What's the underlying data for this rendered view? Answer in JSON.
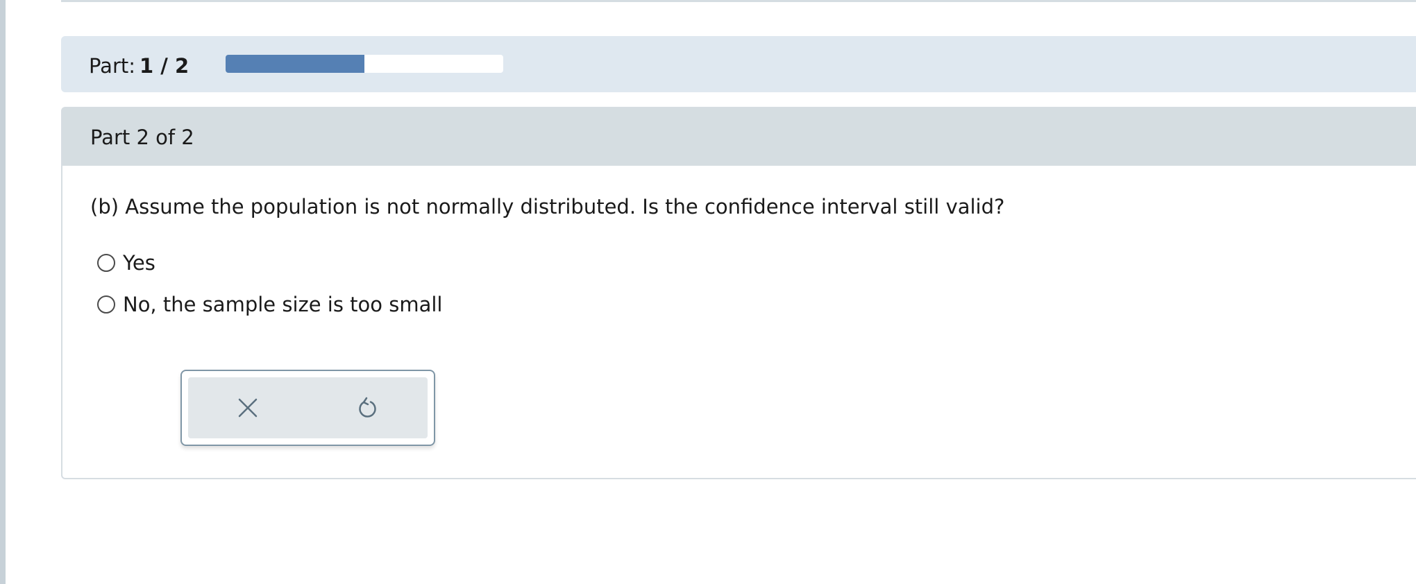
{
  "progress": {
    "label": "Part:",
    "counter": "1 / 2",
    "fraction": 0.5
  },
  "card": {
    "title": "Part 2 of 2",
    "question": "(b) Assume the population is not normally distributed. Is the confidence interval still valid?",
    "options": [
      {
        "label": "Yes",
        "selected": false
      },
      {
        "label": "No, the sample size is too small",
        "selected": false
      }
    ]
  },
  "toolbar": {
    "clear_icon": "x-icon",
    "undo_icon": "undo-icon"
  },
  "colors": {
    "banner_bg": "#dfe8f0",
    "progress_fill": "#5580b4",
    "card_header_bg": "#d5dde1",
    "toolbar_icon": "#5a6f7e"
  }
}
